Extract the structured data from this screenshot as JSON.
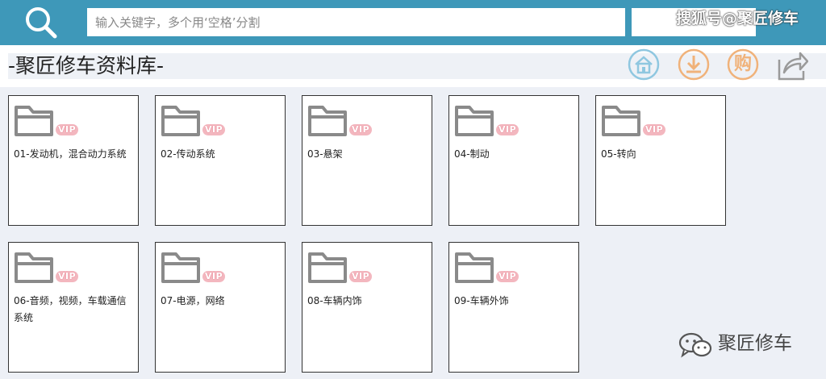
{
  "search": {
    "placeholder": "输入关键字，多个用‘空格’分割",
    "button_label": ""
  },
  "watermark_top": "搜狐号@聚匠修车",
  "page_title": "-聚匠修车资料库-",
  "toolbar": {
    "home_icon": "home-icon",
    "download_icon": "download-icon",
    "buy_label": "购",
    "share_icon": "share-icon"
  },
  "folders": [
    {
      "label": "01-发动机，混合动力系统",
      "badge": "VIP"
    },
    {
      "label": "02-传动系统",
      "badge": "VIP"
    },
    {
      "label": "03-悬架",
      "badge": "VIP"
    },
    {
      "label": "04-制动",
      "badge": "VIP"
    },
    {
      "label": "05-转向",
      "badge": "VIP"
    },
    {
      "label": "06-音频，视频，车载通信系统",
      "badge": "VIP"
    },
    {
      "label": "07-电源，网络",
      "badge": "VIP"
    },
    {
      "label": "08-车辆内饰",
      "badge": "VIP"
    },
    {
      "label": "09-车辆外饰",
      "badge": "VIP"
    }
  ],
  "watermark_bottom": "聚匠修车",
  "colors": {
    "topbar": "#3e98b9",
    "grid_background": "#edf0f6",
    "icon_orange": "#f0b27a",
    "icon_blue": "#8fc7e0"
  }
}
